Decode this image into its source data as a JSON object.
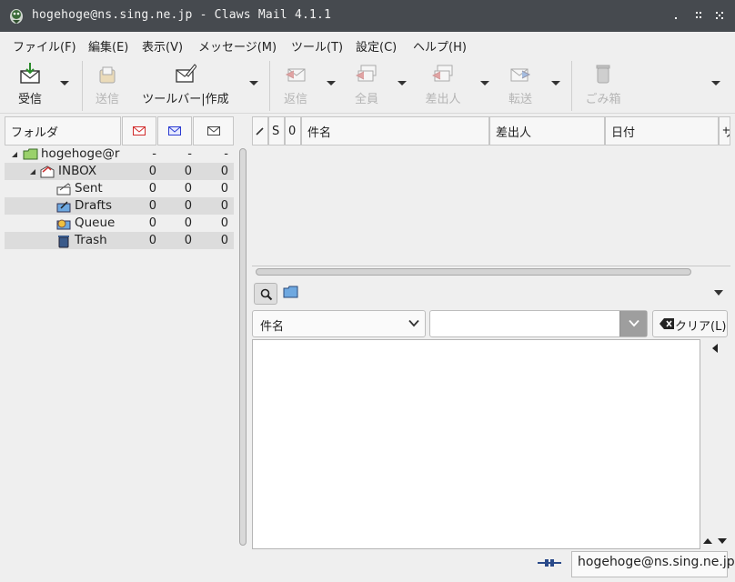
{
  "window": {
    "title": "hogehoge@ns.sing.ne.jp - Claws Mail 4.1.1"
  },
  "menu": [
    "ファイル(F)",
    "編集(E)",
    "表示(V)",
    "メッセージ(M)",
    "ツール(T)",
    "設定(C)",
    "ヘルプ(H)"
  ],
  "toolbar": {
    "receive": "受信",
    "send": "送信",
    "compose": "ツールバー|作成",
    "reply": "返信",
    "reply_all": "全員",
    "reply_sender": "差出人",
    "forward": "転送",
    "trash": "ごみ箱"
  },
  "folder_pane": {
    "header": "フォルダ",
    "rows": [
      {
        "name": "hogehoge@r",
        "unread": "-",
        "new": "-",
        "total": "-"
      },
      {
        "name": "INBOX",
        "unread": "0",
        "new": "0",
        "total": "0"
      },
      {
        "name": "Sent",
        "unread": "0",
        "new": "0",
        "total": "0"
      },
      {
        "name": "Drafts",
        "unread": "0",
        "new": "0",
        "total": "0"
      },
      {
        "name": "Queue",
        "unread": "0",
        "new": "0",
        "total": "0"
      },
      {
        "name": "Trash",
        "unread": "0",
        "new": "0",
        "total": "0"
      }
    ]
  },
  "message_list": {
    "columns": {
      "mark": "",
      "status": "S",
      "attach": "0",
      "subject": "件名",
      "from": "差出人",
      "date": "日付",
      "extra": "サ"
    }
  },
  "search": {
    "field_selected": "件名",
    "input_value": "",
    "clear_label": "クリア(L)"
  },
  "status": {
    "account": "hogehoge@ns.sing.ne.jp"
  },
  "colors": {
    "titlebar": "#464a4f",
    "background": "#efefef",
    "alt_row": "#dcdcdc"
  }
}
